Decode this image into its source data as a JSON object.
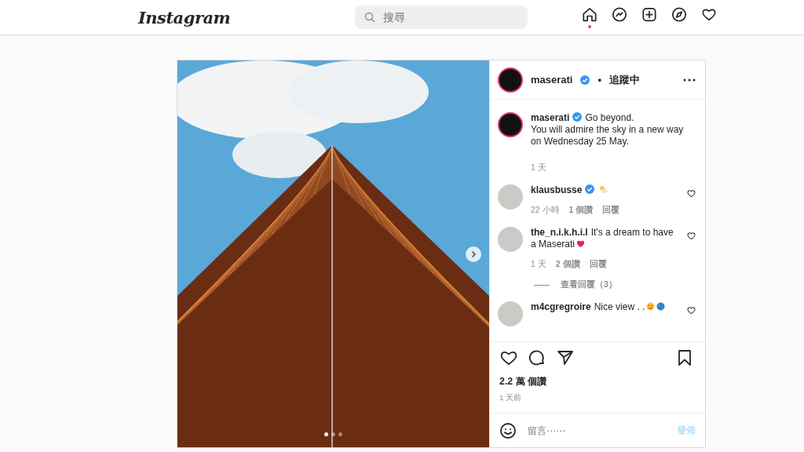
{
  "top_bar": {
    "logo": "Instagram",
    "search": {
      "placeholder": "搜尋"
    },
    "nav": [
      {
        "kind": "home",
        "selected": true
      },
      {
        "kind": "messenger",
        "selected": false
      },
      {
        "kind": "create",
        "selected": false
      },
      {
        "kind": "explore",
        "selected": false
      },
      {
        "kind": "activity",
        "selected": false
      }
    ]
  },
  "post": {
    "slides": [
      {
        "selected": true
      },
      {
        "selected": false
      },
      {
        "selected": false
      }
    ],
    "header": {
      "username": "maserati",
      "verified": true,
      "separator": "•",
      "follow_status": "追蹤中"
    },
    "caption": {
      "username": "maserati",
      "verified": true,
      "text": "Go beyond.\nYou will admire the sky in a new way on Wednesday 25 May.",
      "time": "1 天"
    },
    "comments": [
      {
        "username": "klausbusse",
        "verified": true,
        "emoji": [
          {
            "kind": "sun"
          }
        ],
        "time": "22 小時",
        "likes": "1 個讚",
        "reply": "回覆"
      },
      {
        "username": "the_n.i.k.h.i.l",
        "verified": false,
        "text": "It's a dream to have a Maserati",
        "emoji": [
          {
            "kind": "heart"
          }
        ],
        "time": "1 天",
        "likes": "2 個讚",
        "reply": "回覆",
        "view_replies": "查看回覆（3）"
      },
      {
        "username": "m4cgregroire",
        "verified": false,
        "text": "Nice view . .",
        "emoji": [
          {
            "kind": "smile"
          },
          {
            "kind": "globe"
          }
        ]
      }
    ],
    "likes": "2.2 萬 個讚",
    "posted": "1 天前",
    "comment_box": {
      "placeholder": "留言⋯⋯",
      "post_button": "發佈"
    }
  }
}
